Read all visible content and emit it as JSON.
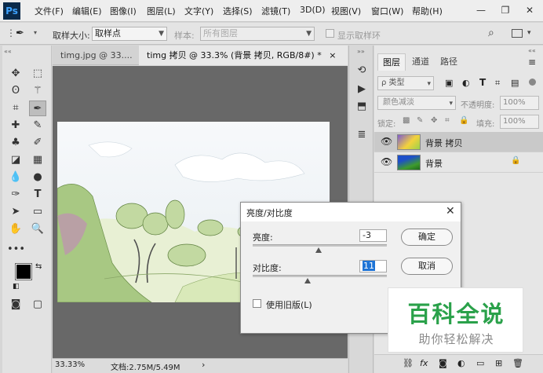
{
  "app": {
    "logo": "Ps"
  },
  "menu": [
    "文件(F)",
    "编辑(E)",
    "图像(I)",
    "图层(L)",
    "文字(Y)",
    "选择(S)",
    "滤镜(T)",
    "3D(D)",
    "视图(V)",
    "窗口(W)",
    "帮助(H)"
  ],
  "window_controls": {
    "minimize": "—",
    "restore": "❐",
    "close": "✕"
  },
  "options": {
    "sample_size_label": "取样大小:",
    "sample_size_value": "取样点",
    "sample_label": "样本:",
    "sample_value": "所有图层",
    "show_ring_label": "显示取样环"
  },
  "tabs": [
    {
      "label": "timg.jpg @ 33....",
      "close": "×"
    },
    {
      "label": "timg 拷贝 @ 33.3% (背景 拷贝, RGB/8#) *",
      "close": "×"
    }
  ],
  "status": {
    "zoom": "33.33%",
    "doc_info": "文档:2.75M/5.49M",
    "arrow": "›"
  },
  "panel": {
    "tabs": [
      "图层",
      "通道",
      "路径"
    ],
    "filter_label": "ρ 类型",
    "blend_mode": "颜色减淡",
    "opacity_label": "不透明度:",
    "opacity_value": "100%",
    "lock_label": "锁定:",
    "fill_label": "填充:",
    "fill_value": "100%",
    "layers": [
      {
        "name": "背景 拷贝",
        "selected": true
      },
      {
        "name": "背景",
        "selected": false
      }
    ],
    "lock_glyph": "🔒",
    "footer_icons": [
      "link",
      "fx",
      "mask",
      "adjust",
      "folder",
      "new",
      "trash"
    ]
  },
  "dialog": {
    "title": "亮度/对比度",
    "brightness_label": "亮度:",
    "brightness_value": "-3",
    "contrast_label": "对比度:",
    "contrast_value": "11",
    "ok_label": "确定",
    "cancel_label": "取消",
    "legacy_label": "使用旧版(L)",
    "brightness_level": -3,
    "contrast_level": 11
  },
  "watermark": {
    "title": "百科全说",
    "subtitle": "助你轻松解决"
  },
  "colors": {
    "accent": "#1473e6",
    "foreground": "#000000",
    "background": "#ffffff",
    "watermark_green": "#2aa14a"
  }
}
